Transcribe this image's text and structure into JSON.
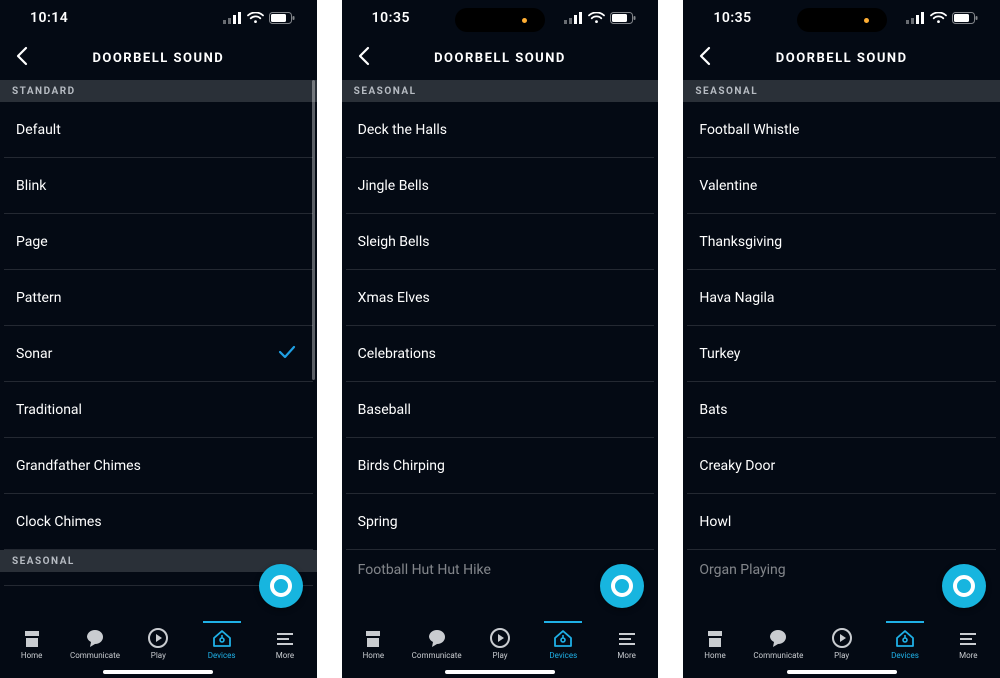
{
  "header_title": "DOORBELL SOUND",
  "tabs": {
    "home": "Home",
    "communicate": "Communicate",
    "play": "Play",
    "devices": "Devices",
    "more": "More"
  },
  "sections": {
    "standard": "STANDARD",
    "seasonal": "SEASONAL"
  },
  "screens": [
    {
      "time": "10:14",
      "show_pill": false,
      "scroll_thumb": true,
      "groups": [
        {
          "header": "standard",
          "items": [
            {
              "label": "Default"
            },
            {
              "label": "Blink"
            },
            {
              "label": "Page"
            },
            {
              "label": "Pattern"
            },
            {
              "label": "Sonar",
              "selected": true
            },
            {
              "label": "Traditional"
            },
            {
              "label": "Grandfather Chimes"
            },
            {
              "label": "Clock Chimes"
            }
          ]
        },
        {
          "header": "seasonal",
          "items": [
            {
              "label": " ",
              "tiny": true
            }
          ]
        }
      ]
    },
    {
      "time": "10:35",
      "show_pill": true,
      "scroll_thumb": false,
      "groups": [
        {
          "header": "seasonal",
          "items": [
            {
              "label": "Deck the Halls"
            },
            {
              "label": "Jingle Bells"
            },
            {
              "label": "Sleigh Bells"
            },
            {
              "label": "Xmas Elves"
            },
            {
              "label": "Celebrations"
            },
            {
              "label": "Baseball"
            },
            {
              "label": "Birds Chirping"
            },
            {
              "label": "Spring"
            },
            {
              "label": "Football Hut Hut Hike",
              "cut": true
            }
          ]
        }
      ]
    },
    {
      "time": "10:35",
      "show_pill": true,
      "scroll_thumb": false,
      "groups": [
        {
          "header": "seasonal",
          "items": [
            {
              "label": "Football Whistle"
            },
            {
              "label": "Valentine"
            },
            {
              "label": "Thanksgiving"
            },
            {
              "label": "Hava Nagila"
            },
            {
              "label": "Turkey"
            },
            {
              "label": "Bats"
            },
            {
              "label": "Creaky Door"
            },
            {
              "label": "Howl"
            },
            {
              "label": "Organ Playing",
              "cut": true
            }
          ]
        }
      ]
    }
  ]
}
